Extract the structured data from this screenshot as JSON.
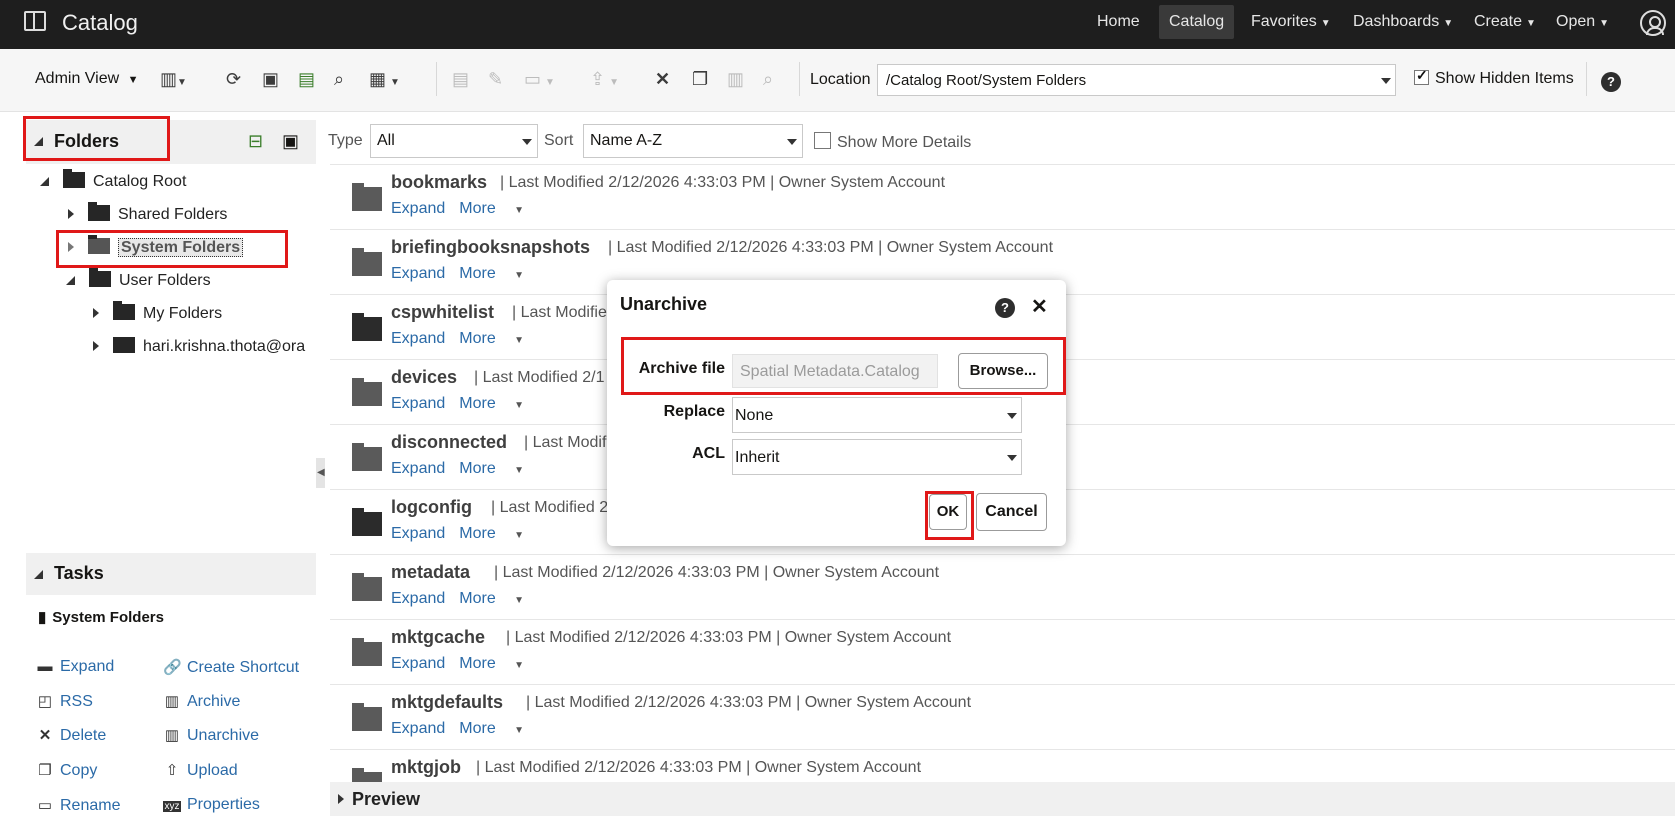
{
  "app": {
    "title": "Catalog"
  },
  "nav": {
    "home": "Home",
    "catalog": "Catalog",
    "favorites": "Favorites",
    "dashboards": "Dashboards",
    "create": "Create",
    "open": "Open"
  },
  "toolbar": {
    "view_label": "Admin View",
    "location_label": "Location",
    "location_value": "/Catalog Root/System Folders",
    "show_hidden_label": "Show Hidden Items",
    "show_hidden_checked": true
  },
  "folders_panel": {
    "title": "Folders",
    "tree": [
      {
        "label": "Catalog Root"
      },
      {
        "label": "Shared Folders"
      },
      {
        "label": "System Folders"
      },
      {
        "label": "User Folders"
      },
      {
        "label": "My Folders"
      },
      {
        "label": "hari.krishna.thota@ora"
      }
    ]
  },
  "tasks_panel": {
    "title": "Tasks",
    "context": "System Folders",
    "links": {
      "expand": "Expand",
      "create_shortcut": "Create Shortcut",
      "rss": "RSS",
      "archive": "Archive",
      "delete": "Delete",
      "unarchive": "Unarchive",
      "copy": "Copy",
      "upload": "Upload",
      "rename": "Rename",
      "properties": "Properties"
    }
  },
  "filter": {
    "type_label": "Type",
    "type_value": "All",
    "sort_label": "Sort",
    "sort_value": "Name A-Z",
    "more_details_label": "Show More Details"
  },
  "items": [
    {
      "name": "bookmarks",
      "meta": "Last Modified 2/12/2026 4:33:03 PM",
      "owner": "Owner System Account"
    },
    {
      "name": "briefingbooksnapshots",
      "meta": "Last Modified 2/12/2026 4:33:03 PM",
      "owner": "Owner System Account"
    },
    {
      "name": "cspwhitelist",
      "meta": "Last Modifie",
      "owner": ""
    },
    {
      "name": "devices",
      "meta": "Last Modified 2/1",
      "owner": ""
    },
    {
      "name": "disconnected",
      "meta": "Last Modif",
      "owner": ""
    },
    {
      "name": "logconfig",
      "meta": "Last Modified 2",
      "owner": ""
    },
    {
      "name": "metadata",
      "meta": "Last Modified 2/12/2026 4:33:03 PM",
      "owner": "Owner System Account"
    },
    {
      "name": "mktgcache",
      "meta": "Last Modified 2/12/2026 4:33:03 PM",
      "owner": "Owner System Account"
    },
    {
      "name": "mktgdefaults",
      "meta": "Last Modified 2/12/2026 4:33:03 PM",
      "owner": "Owner System Account"
    },
    {
      "name": "mktgjob",
      "meta": "Last Modified 2/12/2026 4:33:03 PM",
      "owner": "Owner System Account"
    }
  ],
  "item_links": {
    "expand": "Expand",
    "more": "More"
  },
  "preview": {
    "label": "Preview"
  },
  "dialog": {
    "title": "Unarchive",
    "archive_label": "Archive file",
    "archive_value": "Spatial Metadata.Catalog",
    "browse_label": "Browse...",
    "replace_label": "Replace",
    "replace_value": "None",
    "acl_label": "ACL",
    "acl_value": "Inherit",
    "ok_label": "OK",
    "cancel_label": "Cancel"
  },
  "colors": {
    "highlight": "#e01818",
    "link": "#2b6aa7",
    "topbar": "#1e1e1e"
  }
}
